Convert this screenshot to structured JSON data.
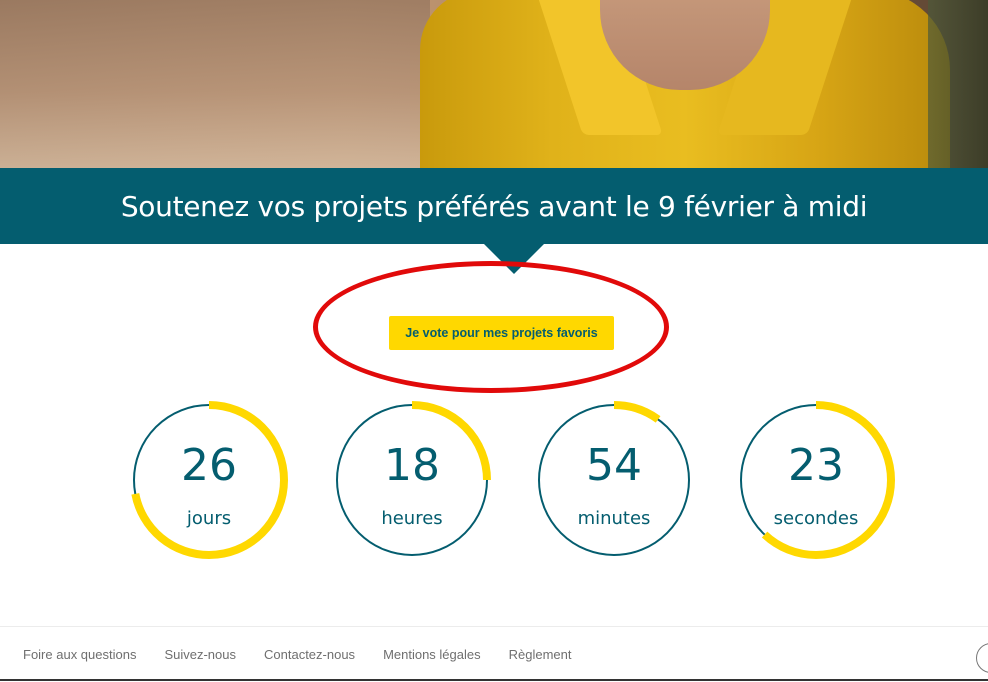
{
  "banner": {
    "title": "Soutenez vos projets préférés avant le 9 février à midi"
  },
  "cta": {
    "vote_label": "Je vote pour mes projets favoris"
  },
  "countdown": [
    {
      "value": "26",
      "unit": "jours",
      "progress_fraction": 0.72
    },
    {
      "value": "18",
      "unit": "heures",
      "progress_fraction": 0.25
    },
    {
      "value": "54",
      "unit": "minutes",
      "progress_fraction": 0.1
    },
    {
      "value": "23",
      "unit": "secondes",
      "progress_fraction": 0.62
    }
  ],
  "footer": {
    "links": [
      "Foire aux questions",
      "Suivez-nous",
      "Contactez-nous",
      "Mentions légales",
      "Règlement"
    ],
    "scroll_top_icon": "chevron-up-icon"
  },
  "colors": {
    "primary": "#045d6f",
    "accent": "#ffd800",
    "annotation": "#e10a0a",
    "footer_text": "#6f6f6f"
  }
}
